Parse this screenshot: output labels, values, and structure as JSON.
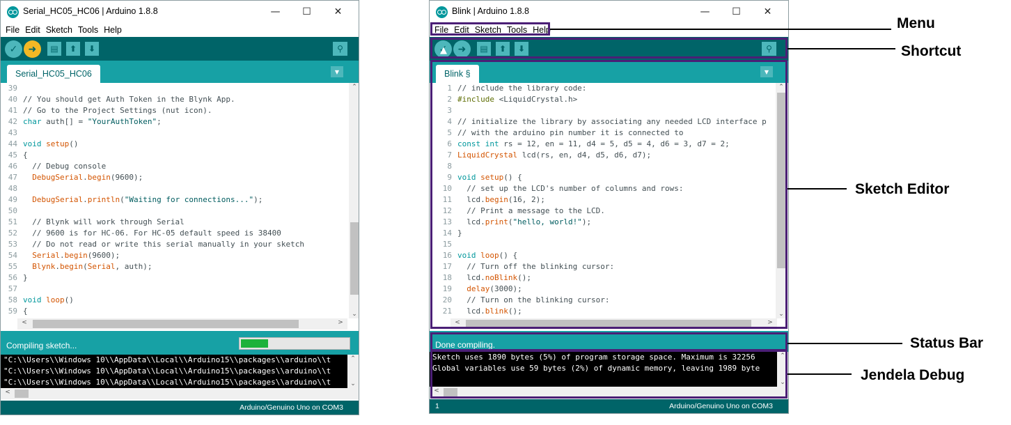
{
  "left_window": {
    "title": "Serial_HC05_HC06 | Arduino 1.8.8",
    "menu": [
      "File",
      "Edit",
      "Sketch",
      "Tools",
      "Help"
    ],
    "toolbar": {
      "verify_icon": "check-icon",
      "upload_icon": "arrow-right-icon",
      "new_icon": "new-file-icon",
      "open_icon": "open-up-arrow-icon",
      "save_icon": "save-down-arrow-icon",
      "serial_icon": "magnifier-icon"
    },
    "tab": "Serial_HC05_HC06",
    "code_lines": [
      {
        "n": "39",
        "t": ""
      },
      {
        "n": "40",
        "t": "// You should get Auth Token in the Blynk App."
      },
      {
        "n": "41",
        "t": "// Go to the Project Settings (nut icon)."
      },
      {
        "n": "42",
        "t": "char auth[] = \"YourAuthToken\";"
      },
      {
        "n": "43",
        "t": ""
      },
      {
        "n": "44",
        "t": "void setup()"
      },
      {
        "n": "45",
        "t": "{"
      },
      {
        "n": "46",
        "t": "  // Debug console"
      },
      {
        "n": "47",
        "t": "  DebugSerial.begin(9600);"
      },
      {
        "n": "48",
        "t": ""
      },
      {
        "n": "49",
        "t": "  DebugSerial.println(\"Waiting for connections...\");"
      },
      {
        "n": "50",
        "t": ""
      },
      {
        "n": "51",
        "t": "  // Blynk will work through Serial"
      },
      {
        "n": "52",
        "t": "  // 9600 is for HC-06. For HC-05 default speed is 38400"
      },
      {
        "n": "53",
        "t": "  // Do not read or write this serial manually in your sketch"
      },
      {
        "n": "54",
        "t": "  Serial.begin(9600);"
      },
      {
        "n": "55",
        "t": "  Blynk.begin(Serial, auth);"
      },
      {
        "n": "56",
        "t": "}"
      },
      {
        "n": "57",
        "t": ""
      },
      {
        "n": "58",
        "t": "void loop()"
      },
      {
        "n": "59",
        "t": "{"
      }
    ],
    "status": "Compiling sketch...",
    "progress": 0.25,
    "console_lines": [
      "\"C:\\\\Users\\\\Windows 10\\\\AppData\\\\Local\\\\Arduino15\\\\packages\\\\arduino\\\\t",
      "\"C:\\\\Users\\\\Windows 10\\\\AppData\\\\Local\\\\Arduino15\\\\packages\\\\arduino\\\\t",
      "\"C:\\\\Users\\\\Windows 10\\\\AppData\\\\Local\\\\Arduino15\\\\packages\\\\arduino\\\\t"
    ],
    "line_number": "",
    "board": "Arduino/Genuino Uno on COM3"
  },
  "right_window": {
    "title": "Blink | Arduino 1.8.8",
    "menu": [
      "File",
      "Edit",
      "Sketch",
      "Tools",
      "Help"
    ],
    "tab": "Blink §",
    "code_lines": [
      {
        "n": "1",
        "t": "// include the library code:"
      },
      {
        "n": "2",
        "t": "#include <LiquidCrystal.h>"
      },
      {
        "n": "3",
        "t": ""
      },
      {
        "n": "4",
        "t": "// initialize the library by associating any needed LCD interface p"
      },
      {
        "n": "5",
        "t": "// with the arduino pin number it is connected to"
      },
      {
        "n": "6",
        "t": "const int rs = 12, en = 11, d4 = 5, d5 = 4, d6 = 3, d7 = 2;"
      },
      {
        "n": "7",
        "t": "LiquidCrystal lcd(rs, en, d4, d5, d6, d7);"
      },
      {
        "n": "8",
        "t": ""
      },
      {
        "n": "9",
        "t": "void setup() {"
      },
      {
        "n": "10",
        "t": "  // set up the LCD's number of columns and rows:"
      },
      {
        "n": "11",
        "t": "  lcd.begin(16, 2);"
      },
      {
        "n": "12",
        "t": "  // Print a message to the LCD."
      },
      {
        "n": "13",
        "t": "  lcd.print(\"hello, world!\");"
      },
      {
        "n": "14",
        "t": "}"
      },
      {
        "n": "15",
        "t": ""
      },
      {
        "n": "16",
        "t": "void loop() {"
      },
      {
        "n": "17",
        "t": "  // Turn off the blinking cursor:"
      },
      {
        "n": "18",
        "t": "  lcd.noBlink();"
      },
      {
        "n": "19",
        "t": "  delay(3000);"
      },
      {
        "n": "20",
        "t": "  // Turn on the blinking cursor:"
      },
      {
        "n": "21",
        "t": "  lcd.blink();"
      }
    ],
    "status": "Done compiling.",
    "console_lines": [
      "Sketch uses 1890 bytes (5%) of program storage space. Maximum is 32256",
      "Global variables use 59 bytes (2%) of dynamic memory, leaving 1989 byte"
    ],
    "line_number": "1",
    "board": "Arduino/Genuino Uno on COM3"
  },
  "callouts": {
    "menu": "Menu",
    "shortcut": "Shortcut",
    "editor": "Sketch Editor",
    "status": "Status Bar",
    "debug": "Jendela Debug"
  },
  "colors": {
    "teal_dark": "#006468",
    "teal": "#17a1a5",
    "teal_light": "#4db7bb",
    "upload_active": "#f3b825",
    "progress_fill": "#1db23b",
    "annotation_box": "#4b1f76"
  }
}
